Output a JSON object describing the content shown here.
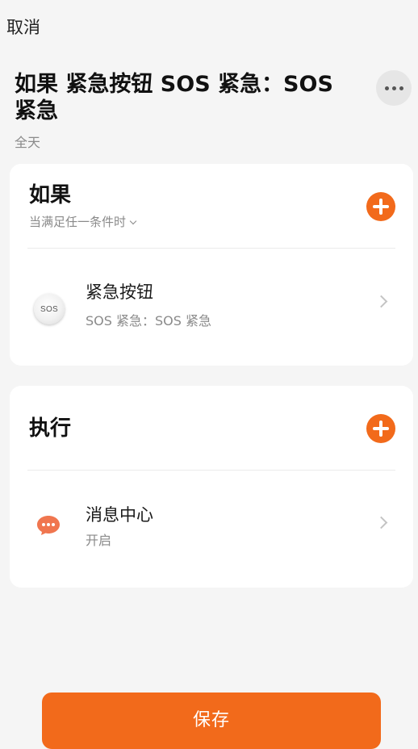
{
  "header": {
    "cancel_label": "取消",
    "title": "如果 紧急按钮 SOS 紧急：SOS 紧急",
    "subtitle": "全天",
    "more_icon": "more-dots-icon"
  },
  "if_section": {
    "title": "如果",
    "condition_label": "当满足任一条件时",
    "add_icon": "plus-icon",
    "items": [
      {
        "icon": "sos-button-icon",
        "icon_text": "SOS",
        "title": "紧急按钮",
        "subtitle": "SOS 紧急：SOS 紧急"
      }
    ]
  },
  "then_section": {
    "title": "执行",
    "add_icon": "plus-icon",
    "items": [
      {
        "icon": "message-bubble-icon",
        "title": "消息中心",
        "subtitle": "开启"
      }
    ]
  },
  "footer": {
    "save_label": "保存"
  },
  "colors": {
    "accent": "#f26a1b",
    "background": "#f5f5f5",
    "card": "#ffffff",
    "secondary_text": "#8a8a8a"
  }
}
